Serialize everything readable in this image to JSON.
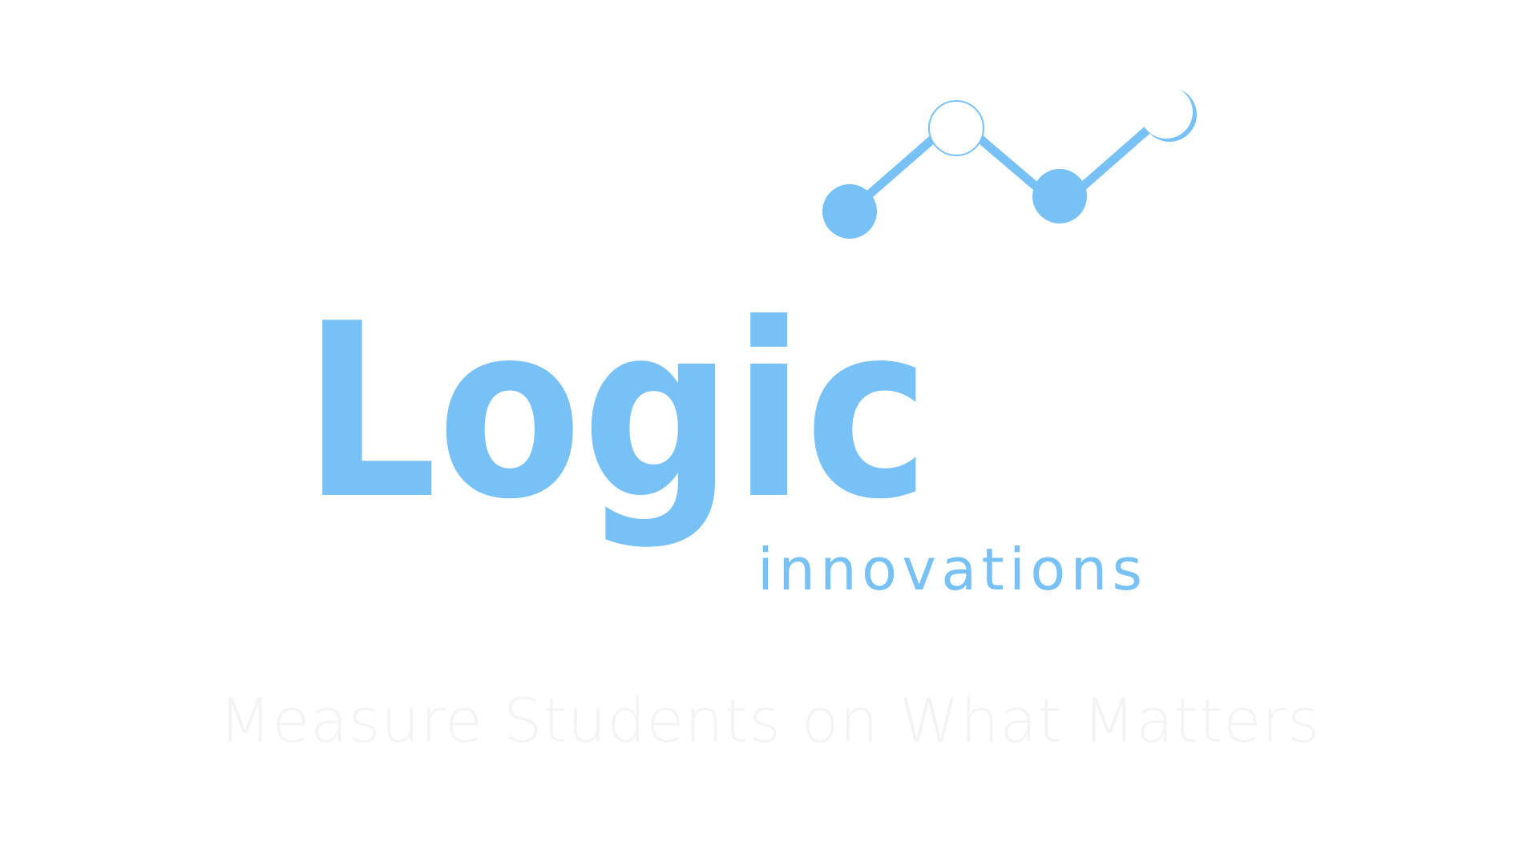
{
  "logo": {
    "wordmark": "Logic",
    "subtitle": "innovations",
    "icon": "line-chart-icon"
  },
  "tagline": "Measure Students on What Matters",
  "colors": {
    "background": "#ffffff",
    "brand_blue": "#77C1F6",
    "tagline": "#f3f3f3"
  }
}
